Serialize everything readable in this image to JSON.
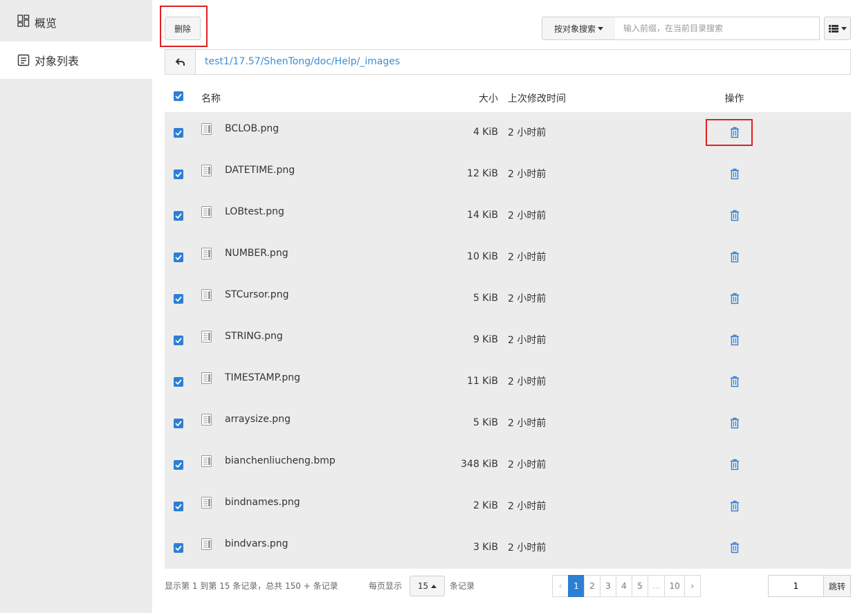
{
  "sidebar": {
    "items": [
      {
        "label": "概览",
        "icon": "grid-icon",
        "active": false
      },
      {
        "label": "对象列表",
        "icon": "list-document-icon",
        "active": true
      }
    ]
  },
  "toolbar": {
    "delete_label": "删除",
    "search_type_label": "按对象搜索",
    "search_placeholder": "输入前缀，在当前目录搜索",
    "view_icon": "list-view-icon"
  },
  "path": {
    "back_icon": "back-arrow-icon",
    "current": "test1/17.57/ShenTong/doc/Help/_images"
  },
  "table": {
    "headers": {
      "name": "名称",
      "size": "大小",
      "modified": "上次修改时间",
      "operations": "操作"
    },
    "rows": [
      {
        "name": "BCLOB.png",
        "size": "4 KiB",
        "modified": "2 小时前"
      },
      {
        "name": "DATETIME.png",
        "size": "12 KiB",
        "modified": "2 小时前"
      },
      {
        "name": "LOBtest.png",
        "size": "14 KiB",
        "modified": "2 小时前"
      },
      {
        "name": "NUMBER.png",
        "size": "10 KiB",
        "modified": "2 小时前"
      },
      {
        "name": "STCursor.png",
        "size": "5 KiB",
        "modified": "2 小时前"
      },
      {
        "name": "STRING.png",
        "size": "9 KiB",
        "modified": "2 小时前"
      },
      {
        "name": "TIMESTAMP.png",
        "size": "11 KiB",
        "modified": "2 小时前"
      },
      {
        "name": "arraysize.png",
        "size": "5 KiB",
        "modified": "2 小时前"
      },
      {
        "name": "bianchenliucheng.bmp",
        "size": "348 KiB",
        "modified": "2 小时前"
      },
      {
        "name": "bindnames.png",
        "size": "2 KiB",
        "modified": "2 小时前"
      },
      {
        "name": "bindvars.png",
        "size": "3 KiB",
        "modified": "2 小时前"
      }
    ]
  },
  "footer": {
    "summary": "显示第 1 到第 15 条记录，总共 150 + 条记录",
    "per_page_prefix": "每页显示",
    "per_page_value": "15",
    "per_page_suffix": "条记录",
    "pages": [
      "‹",
      "1",
      "2",
      "3",
      "4",
      "5",
      "...",
      "10",
      "›"
    ],
    "active_page": "1",
    "jump_value": "1",
    "jump_label": "跳转"
  },
  "colors": {
    "accent": "#2d7fd3",
    "link": "#3a8fd6",
    "highlight": "#e02020",
    "row_bg": "#ececec"
  }
}
